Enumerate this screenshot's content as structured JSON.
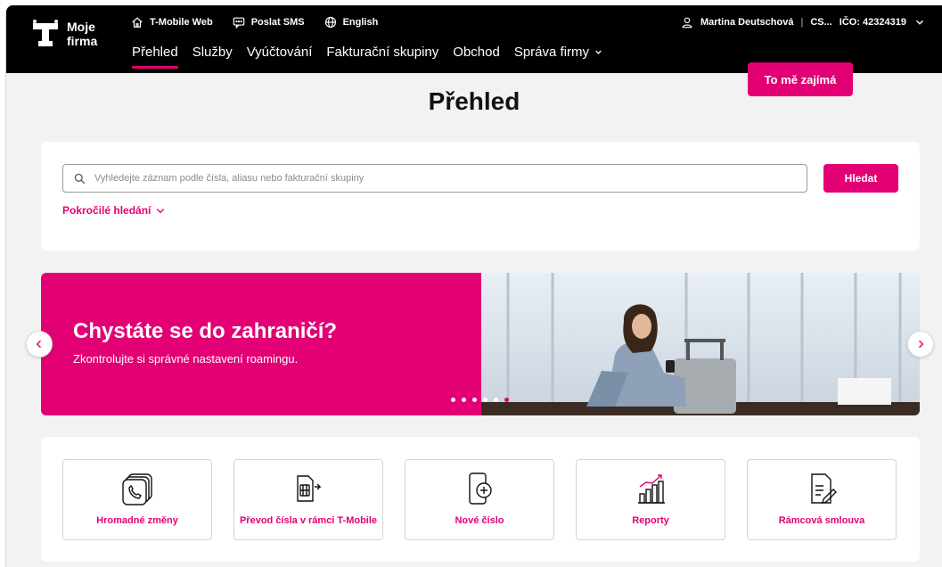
{
  "brand": {
    "line1": "Moje",
    "line2": "firma",
    "logo_icon": "t-mobile-logo-icon"
  },
  "utility": {
    "items": [
      {
        "label": "T-Mobile Web",
        "icon": "home-icon"
      },
      {
        "label": "Poslat SMS",
        "icon": "message-icon"
      },
      {
        "label": "English",
        "icon": "globe-icon"
      }
    ]
  },
  "account": {
    "user": "Martina Deutschová",
    "separator": "|",
    "company": "CS...",
    "ico": "IČO: 42324319",
    "user_icon": "user-icon",
    "chevron_icon": "chevron-down-icon"
  },
  "nav": {
    "items": [
      {
        "label": "Přehled",
        "active": true
      },
      {
        "label": "Služby"
      },
      {
        "label": "Vyúčtování"
      },
      {
        "label": "Fakturační skupiny"
      },
      {
        "label": "Obchod"
      },
      {
        "label": "Správa firmy",
        "dropdown": true
      }
    ]
  },
  "page": {
    "title": "Přehled"
  },
  "search": {
    "placeholder": "Vyhledejte záznam podle čísla, aliasu nebo fakturační skupiny",
    "value": "",
    "button": "Hledat",
    "advanced": "Pokročilé hledání"
  },
  "banner": {
    "title": "Chystáte se do zahraničí?",
    "subtitle": "Zkontrolujte si správné nastavení roamingu.",
    "cta": "To mě zajímá",
    "dots_count": 6,
    "active_dot": 5
  },
  "actions": [
    {
      "label": "Hromadné změny",
      "icon": "phone-stack-icon"
    },
    {
      "label": "Převod čísla v rámci T-Mobile",
      "icon": "sim-transfer-icon"
    },
    {
      "label": "Nové číslo",
      "icon": "phone-plus-icon"
    },
    {
      "label": "Reporty",
      "icon": "bar-chart-icon"
    },
    {
      "label": "Rámcová smlouva",
      "icon": "contract-icon"
    }
  ],
  "colors": {
    "accent": "#e20074",
    "header": "#000000",
    "background": "#f2f2f2"
  }
}
